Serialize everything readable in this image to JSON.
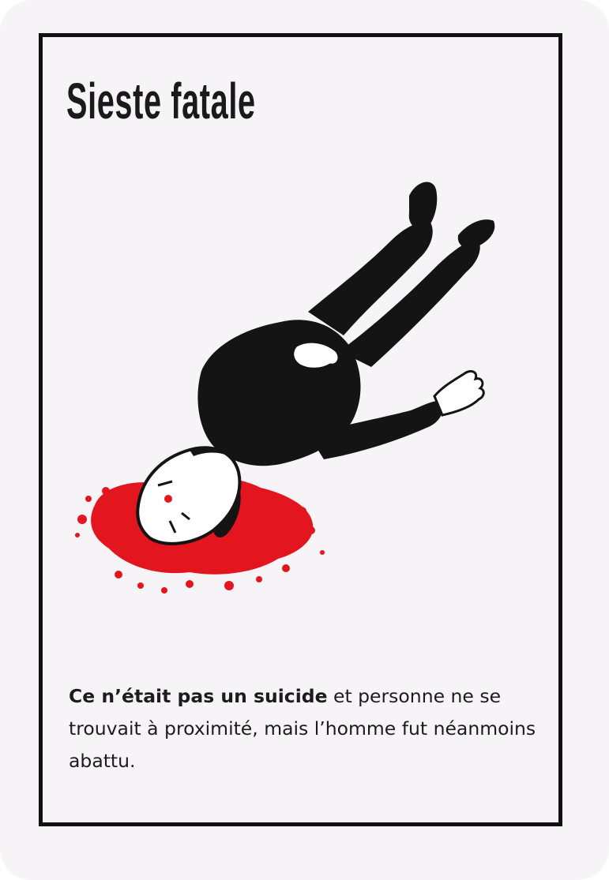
{
  "card": {
    "title": "Sieste fatale",
    "text_bold": "Ce n’était pas un suicide",
    "text_rest": " et personne ne se trouvait à proximité, mais l’homme fut néanmoins abattu."
  },
  "colors": {
    "card_background": "#f7f4f8",
    "border": "#111111",
    "blood": "#e3151e",
    "figure": "#141414"
  },
  "illustration": {
    "icon": "dead-man-lying-in-blood-pool"
  }
}
